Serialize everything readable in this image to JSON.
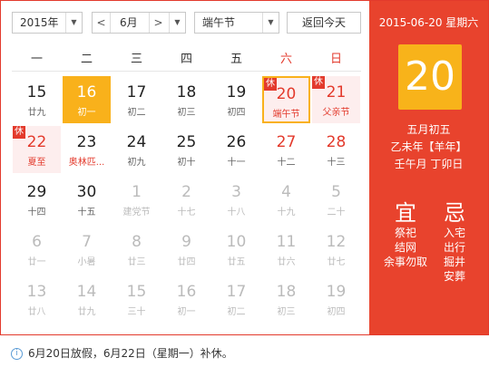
{
  "toolbar": {
    "year_label": "2015年",
    "month_label": "6月",
    "holiday_label": "端午节",
    "today_button": "返回今天",
    "prev_arrow": "<",
    "next_arrow": ">"
  },
  "weekdays": [
    "一",
    "二",
    "三",
    "四",
    "五",
    "六",
    "日"
  ],
  "rows": [
    [
      {
        "n": "15",
        "l": "廿九",
        "type": "normal"
      },
      {
        "n": "16",
        "l": "初一",
        "type": "today"
      },
      {
        "n": "17",
        "l": "初二",
        "type": "normal"
      },
      {
        "n": "18",
        "l": "初三",
        "type": "normal"
      },
      {
        "n": "19",
        "l": "初四",
        "type": "normal"
      },
      {
        "n": "20",
        "l": "端午节",
        "type": "selected",
        "rest": "休"
      },
      {
        "n": "21",
        "l": "父亲节",
        "type": "holiday-weekend",
        "rest": "休"
      }
    ],
    [
      {
        "n": "22",
        "l": "夏至",
        "type": "holiday",
        "rest": "休"
      },
      {
        "n": "23",
        "l": "奥林匹...",
        "type": "festival"
      },
      {
        "n": "24",
        "l": "初九",
        "type": "normal"
      },
      {
        "n": "25",
        "l": "初十",
        "type": "normal"
      },
      {
        "n": "26",
        "l": "十一",
        "type": "normal"
      },
      {
        "n": "27",
        "l": "十二",
        "type": "weekend"
      },
      {
        "n": "28",
        "l": "十三",
        "type": "weekend"
      }
    ],
    [
      {
        "n": "29",
        "l": "十四",
        "type": "normal"
      },
      {
        "n": "30",
        "l": "十五",
        "type": "normal"
      },
      {
        "n": "1",
        "l": "建党节",
        "type": "grey"
      },
      {
        "n": "2",
        "l": "十七",
        "type": "grey"
      },
      {
        "n": "3",
        "l": "十八",
        "type": "grey"
      },
      {
        "n": "4",
        "l": "十九",
        "type": "grey"
      },
      {
        "n": "5",
        "l": "二十",
        "type": "grey"
      }
    ],
    [
      {
        "n": "6",
        "l": "廿一",
        "type": "grey"
      },
      {
        "n": "7",
        "l": "小暑",
        "type": "grey"
      },
      {
        "n": "8",
        "l": "廿三",
        "type": "grey"
      },
      {
        "n": "9",
        "l": "廿四",
        "type": "grey"
      },
      {
        "n": "10",
        "l": "廿五",
        "type": "grey"
      },
      {
        "n": "11",
        "l": "廿六",
        "type": "grey"
      },
      {
        "n": "12",
        "l": "廿七",
        "type": "grey"
      }
    ],
    [
      {
        "n": "13",
        "l": "廿八",
        "type": "grey"
      },
      {
        "n": "14",
        "l": "廿九",
        "type": "grey"
      },
      {
        "n": "15",
        "l": "三十",
        "type": "grey"
      },
      {
        "n": "16",
        "l": "初一",
        "type": "grey"
      },
      {
        "n": "17",
        "l": "初二",
        "type": "grey"
      },
      {
        "n": "18",
        "l": "初三",
        "type": "grey"
      },
      {
        "n": "19",
        "l": "初四",
        "type": "grey"
      }
    ]
  ],
  "panel": {
    "date_line": "2015-06-20 星期六",
    "big_day": "20",
    "lunar": "五月初五",
    "year_gz": "乙未年【羊年】",
    "month_gz": "壬午月 丁卯日",
    "yi_label": "宜",
    "ji_label": "忌",
    "yi_items": [
      "祭祀",
      "结网",
      "余事勿取"
    ],
    "ji_items": [
      "入宅",
      "出行",
      "掘井",
      "安葬"
    ]
  },
  "note": "6月20日放假，6月22日（星期一）补休。",
  "colors": {
    "accent": "#e33a2c",
    "today": "#f9b11b",
    "holiday_bg": "#fdeeee"
  }
}
